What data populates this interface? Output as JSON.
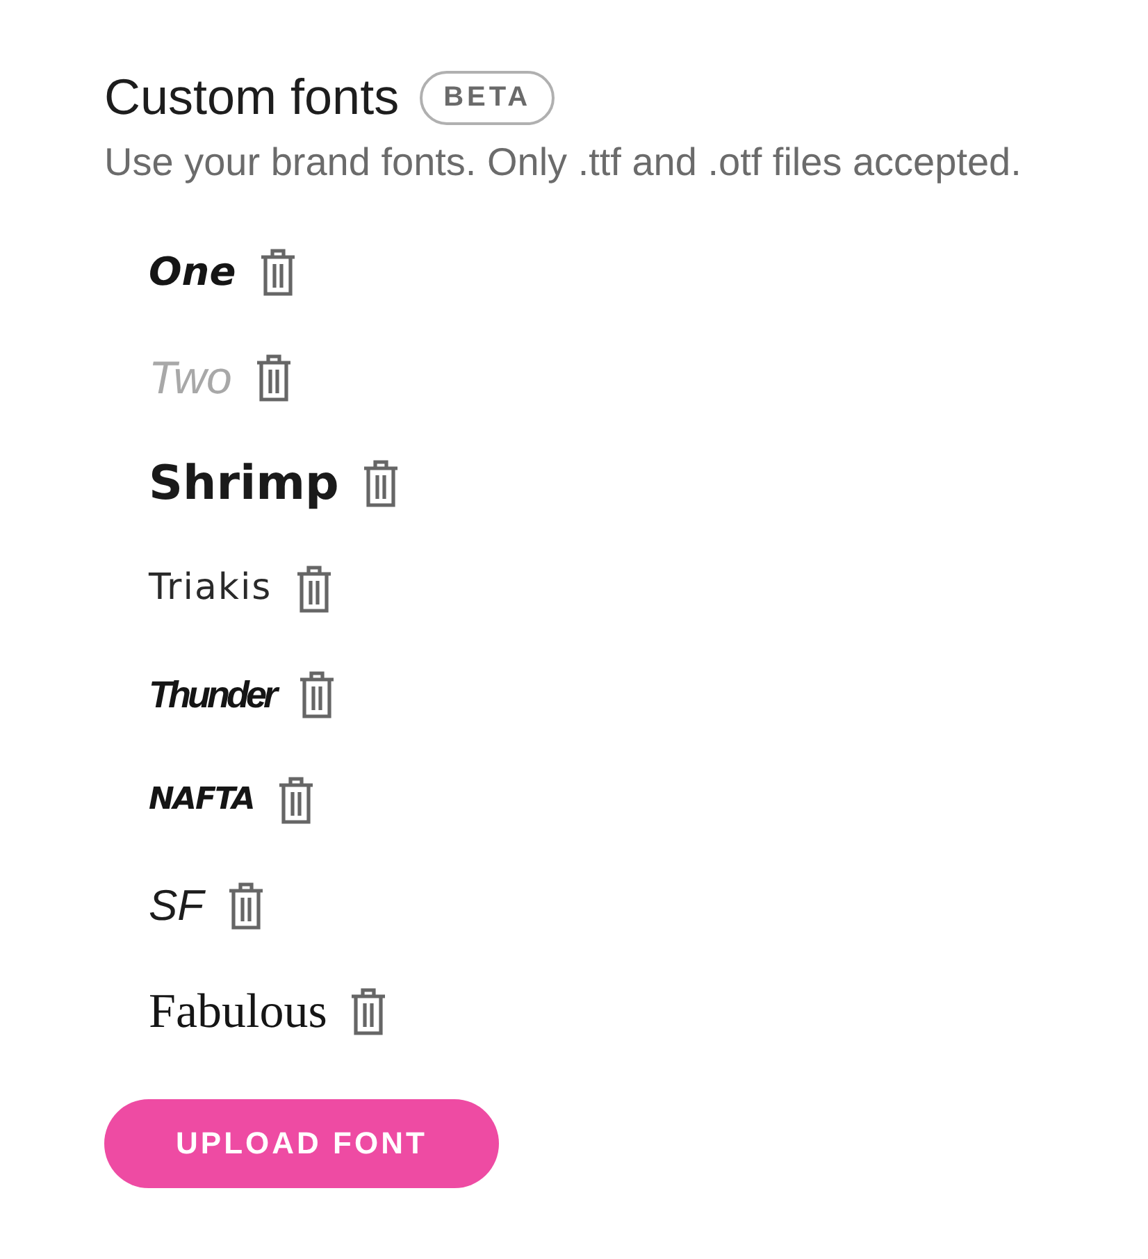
{
  "section": {
    "title": "Custom fonts",
    "badge": "BETA",
    "description": "Use your brand fonts. Only .ttf and .otf files accepted."
  },
  "fonts": [
    {
      "name": "One",
      "kind": "rounded"
    },
    {
      "name": "Two",
      "kind": "thin"
    },
    {
      "name": "Shrimp",
      "kind": "geometric"
    },
    {
      "name": "Triakis",
      "kind": "techno"
    },
    {
      "name": "Thunder",
      "kind": "condensed"
    },
    {
      "name": "NAFTA",
      "kind": "brush"
    },
    {
      "name": "SF",
      "kind": "italic"
    },
    {
      "name": "Fabulous",
      "kind": "serif"
    }
  ],
  "upload_button": {
    "label": "UPLOAD FONT"
  }
}
